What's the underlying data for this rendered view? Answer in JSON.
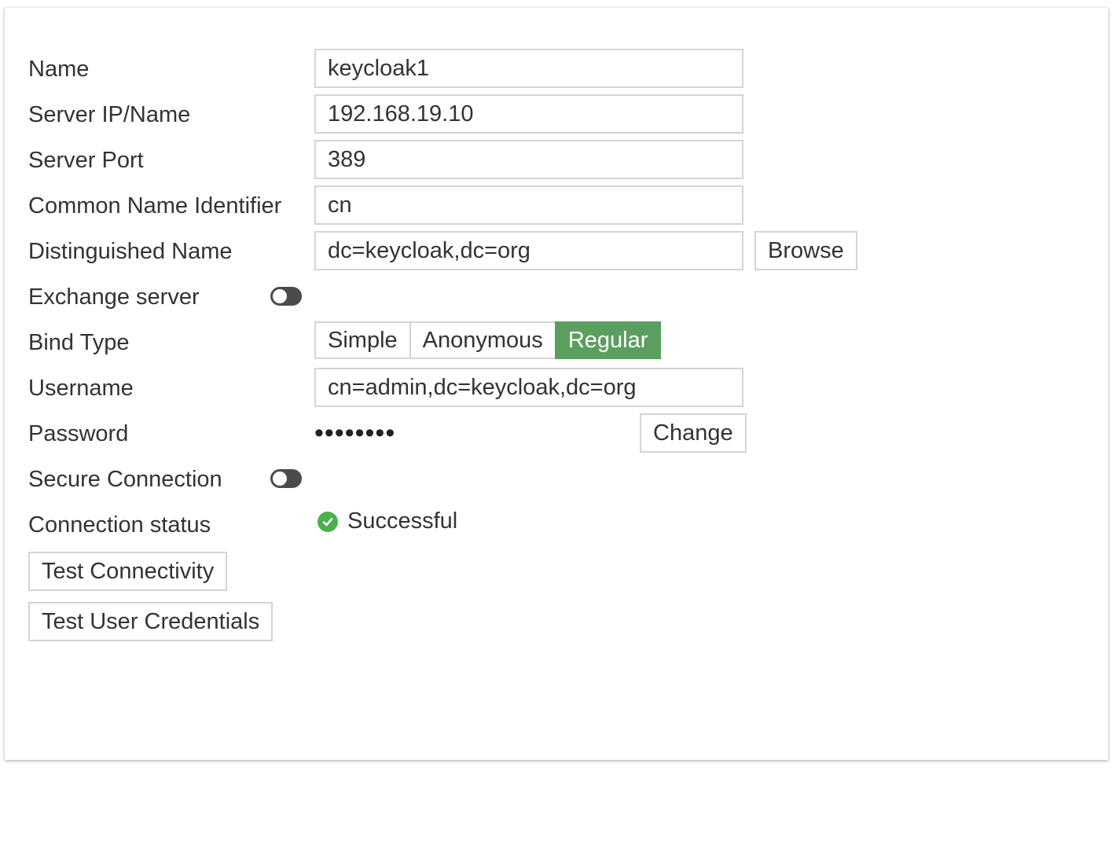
{
  "form": {
    "name": {
      "label": "Name",
      "value": "keycloak1"
    },
    "server_ip": {
      "label": "Server IP/Name",
      "value": "192.168.19.10"
    },
    "server_port": {
      "label": "Server Port",
      "value": "389"
    },
    "cn_identifier": {
      "label": "Common Name Identifier",
      "value": "cn"
    },
    "distinguished_name": {
      "label": "Distinguished Name",
      "value": "dc=keycloak,dc=org",
      "browse_label": "Browse"
    },
    "exchange_server": {
      "label": "Exchange server",
      "enabled": false
    },
    "bind_type": {
      "label": "Bind Type",
      "options": [
        "Simple",
        "Anonymous",
        "Regular"
      ],
      "selected": "Regular"
    },
    "username": {
      "label": "Username",
      "value": "cn=admin,dc=keycloak,dc=org"
    },
    "password": {
      "label": "Password",
      "masked": "••••••••",
      "change_label": "Change"
    },
    "secure_connection": {
      "label": "Secure Connection",
      "enabled": false
    },
    "connection_status": {
      "label": "Connection status",
      "value": "Successful"
    }
  },
  "actions": {
    "test_connectivity": "Test Connectivity",
    "test_user_credentials": "Test User Credentials"
  },
  "colors": {
    "accent_green": "#5a9f5e",
    "success_green": "#4caf50",
    "toggle_off": "#4b4b4b",
    "border": "#d4d4d4"
  },
  "icons": {
    "status": "check-circle-icon"
  }
}
